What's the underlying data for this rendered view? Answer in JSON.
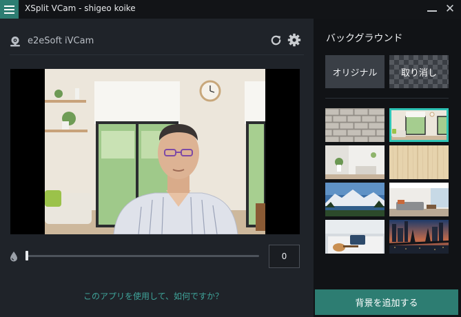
{
  "window": {
    "title": "XSplit VCam - shigeo koike",
    "minimize_glyph": "—",
    "close_glyph": "✕"
  },
  "camera": {
    "name": "e2eSoft iVCam",
    "icons": [
      "webcam-icon",
      "refresh-icon",
      "gear-icon"
    ]
  },
  "slider": {
    "value": "0",
    "level": 0,
    "icon": "blur-drop-icon"
  },
  "feedback": {
    "text": "このアプリを使用して、如何ですか？"
  },
  "background_panel": {
    "heading": "バックグラウンド",
    "original_label": "オリジナル",
    "cancel_label": "取り消し",
    "thumbnails": [
      {
        "id": "brick-wall",
        "selected": false
      },
      {
        "id": "living-room-window",
        "selected": true
      },
      {
        "id": "white-room-plants",
        "selected": false
      },
      {
        "id": "wood-planks",
        "selected": false
      },
      {
        "id": "mountain-lake",
        "selected": false
      },
      {
        "id": "modern-living-room",
        "selected": false
      },
      {
        "id": "bed-guitar",
        "selected": false
      },
      {
        "id": "city-bridge-night",
        "selected": false
      }
    ],
    "add_button_label": "背景を追加する"
  },
  "colors": {
    "accent": "#2d7d72",
    "selection": "#2ec4b6",
    "link": "#3fa49a",
    "panel_dark": "#111316",
    "panel": "#1f2329"
  }
}
